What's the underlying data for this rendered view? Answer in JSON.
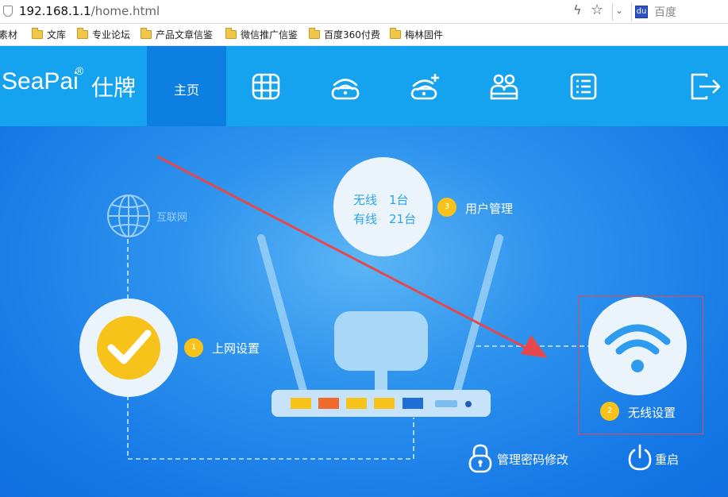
{
  "browser": {
    "url_host": "192.168.1.1",
    "url_path": "/home.html",
    "search_placeholder": "百度",
    "baidu_icon_text": "du"
  },
  "bookmarks": [
    "素材",
    "文库",
    "专业论坛",
    "产品文章信鉴",
    "微信推广信鉴",
    "百度360付费",
    "梅林固件"
  ],
  "nav": {
    "brand": "SeaPai",
    "brand_cn": "仕牌",
    "reg_mark": "®",
    "home_label": "主页",
    "icons": [
      "grid-icon",
      "router-wifi-icon",
      "wifi-add-icon",
      "users-icon",
      "list-icon",
      "logout-icon"
    ]
  },
  "main": {
    "internet_label": "互联网",
    "step1_num": "1",
    "step1_label": "上网设置",
    "step2_num": "2",
    "step2_label": "无线设置",
    "step3_num": "3",
    "step3_label": "用户管理",
    "wireless_count": "无线　1台",
    "wired_count": "有线　21台",
    "password_label": "管理密码修改",
    "reboot_label": "重启"
  },
  "colors": {
    "nav_bg": "#15a3ef",
    "home_tab_bg": "#0d7fe0",
    "badge": "#f7c21a",
    "check_circle": "#f7c21a",
    "annotation": "#e5484d"
  }
}
